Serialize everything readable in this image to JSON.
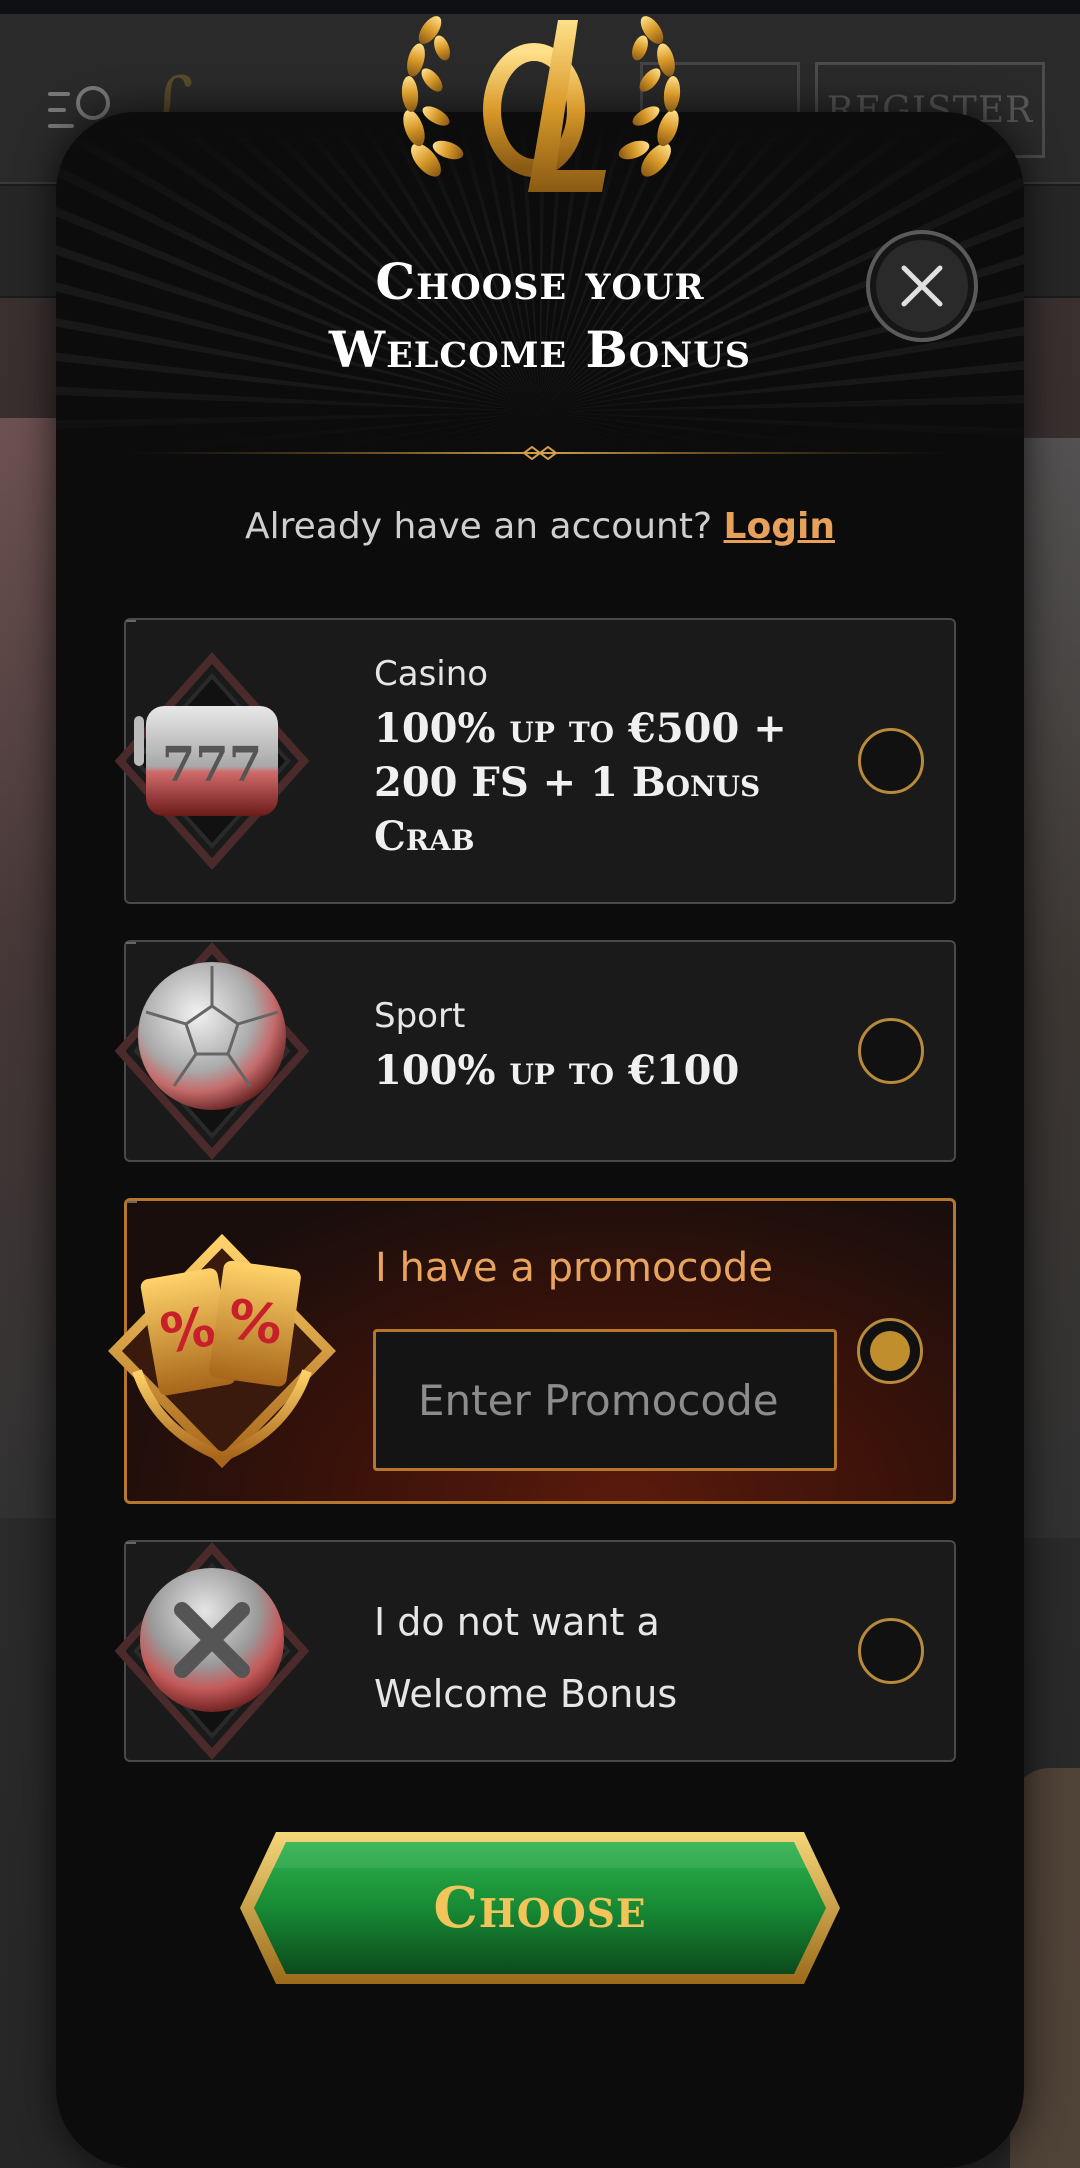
{
  "background": {
    "register_label": "REGISTER"
  },
  "modal": {
    "title_line1": "Choose your",
    "title_line2": "Welcome Bonus",
    "login_prompt": "Already have an account?",
    "login_link": "Login"
  },
  "options": {
    "casino": {
      "label": "Casino",
      "value_line1": "100% up to €500 +",
      "value_line2": "200 FS + 1 Bonus",
      "value_line3": "Crab",
      "icon": "slot-machine-777-icon",
      "selected": false
    },
    "sport": {
      "label": "Sport",
      "value": "100% up to €100",
      "icon": "soccer-ball-icon",
      "selected": false
    },
    "promo": {
      "label": "I have a promocode",
      "input_placeholder": "Enter Promocode",
      "input_value": "",
      "icon": "percent-tickets-icon",
      "selected": true
    },
    "nobonus": {
      "label_line1": "I do not want a",
      "label_line2": "Welcome Bonus",
      "icon": "x-mark-icon",
      "selected": false
    }
  },
  "actions": {
    "choose_label": "Choose"
  },
  "colors": {
    "accent_gold": "#c08e2c",
    "link_orange": "#e7a15a",
    "button_green": "#1f8a3a"
  }
}
